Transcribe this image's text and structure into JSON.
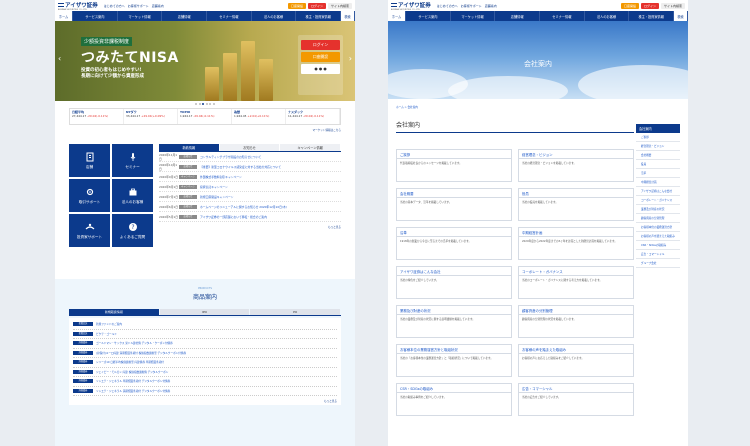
{
  "left": {
    "logo": {
      "name": "アイザワ証券",
      "sub": "AIZAWA SECURITIES CO.,LTD."
    },
    "top_links": [
      "はじめての方へ",
      "お客様サポート",
      "店舗案内"
    ],
    "buttons": {
      "account": "口座開設",
      "login": "ログイン",
      "search": "サイト内検索"
    },
    "nav": [
      "ホーム",
      "サービス案内",
      "マーケット情報",
      "店舗情報",
      "セミナー情報",
      "法人のお客様",
      "株主・投資家情報",
      "検索"
    ],
    "hero": {
      "tag": "少額投資非課税制度",
      "title": "つみたてNISA",
      "caption_1": "投資の初心者もはじめやすい!",
      "caption_2": "長期に向けて少額から資産形成",
      "login_label": "ログイン",
      "account_label": "口座開設",
      "prev": "‹",
      "next": "›"
    },
    "market": [
      {
        "name": "日経平均",
        "value": "27,444.17",
        "change": "-29.04(-0.11%)"
      },
      {
        "name": "NYダウ",
        "value": "33,444.17",
        "change": "+29.04(+0.09%)"
      },
      {
        "name": "TOPIX",
        "value": "1,944.17",
        "change": "-29.04(-0.11%)"
      },
      {
        "name": "為替",
        "value": "1,944.45",
        "change": "+2.04(+0.11%)"
      },
      {
        "name": "ナスダック",
        "value": "11,444.17",
        "change": "-29.04(-0.11%)"
      }
    ],
    "market_note": "マーケット情報はこちら",
    "tiles": [
      "店舗",
      "セミナー",
      "取引サポート",
      "法人のお客様",
      "投資家サポート",
      "よくあるご質問"
    ],
    "news_tabs": [
      "新着情報",
      "お知らせ",
      "キャンペーン情報"
    ],
    "news": [
      {
        "date": "2020年11月1日",
        "cat": "お知らせ",
        "title": "コンサルティングプラザ開設のお知らせについて"
      },
      {
        "date": "2020年10月1日",
        "cat": "お知らせ",
        "title": "【重要】新型コロナウイルス感染症に対する当社の対応について"
      },
      {
        "date": "2020年9月1日",
        "cat": "キャンペーン",
        "title": "外国株式手数料割引キャンペーン"
      },
      {
        "date": "2020年8月1日",
        "cat": "キャンペーン",
        "title": "投資信託キャンペーン"
      },
      {
        "date": "2020年7月1日",
        "cat": "お知らせ",
        "title": "新規口座開設キャンペーン"
      },
      {
        "date": "2020年6月1日",
        "cat": "お知らせ",
        "title": "ホームページのリニューアルに関するお知らせ 2020年12月10日(木)"
      },
      {
        "date": "2020年5月1日",
        "cat": "お知らせ",
        "title": "アイザワ証券の一部店舗において移転・統合のご案内"
      }
    ],
    "news_more": "もっと見る",
    "products": {
      "sub": "PRODUCTS",
      "title": "商品案内",
      "tabs": [
        "新規取扱情報",
        "IPO",
        "PO"
      ],
      "items": [
        {
          "cat": "投資信託",
          "title": "新規ファンドのご案内"
        },
        {
          "cat": "投資信託",
          "title": "ピクテ・ゴールド"
        },
        {
          "cat": "外国債券",
          "title": "ゴールドマン・サックス 米ドル建社債 デジタル・クーポン付債券"
        },
        {
          "cat": "外国債券",
          "title": "(担保付)ユーロ円建 満期償還条項付 株価指数連動型 デジタルクーポン付債券"
        },
        {
          "cat": "外国債券",
          "title": "シリーズ10 日経平均株価連動型 円建債券 早期償還条項付"
        },
        {
          "cat": "外国債券",
          "title": "ジェイピー・モルガン 円建 株価指数連動債 デジタルクーポン"
        },
        {
          "cat": "外国債券",
          "title": "ソシエテ・ジェネラル 早期償還条項付 デジタルクーポン付債券"
        },
        {
          "cat": "外国債券",
          "title": "ソシエテ・ジェネラル 満期償還条項付 デジタルクーポン付債券"
        }
      ],
      "more": "もっと見る"
    }
  },
  "right": {
    "page_title": "会社案内",
    "breadcrumb": "ホーム > 会社案内",
    "cards": [
      {
        "title": "ご挨拶",
        "desc": "代表取締役社長からのメッセージを掲載しています。"
      },
      {
        "title": "経営理念・ビジョン",
        "desc": "当社の経営理念・ビジョンを掲載しています。"
      },
      {
        "title": "会社概要",
        "desc": "当社の基本データ、沿革を掲載しています。"
      },
      {
        "title": "役員",
        "desc": "当社の役員を掲載しています。"
      },
      {
        "title": "沿革",
        "desc": "1918年の創業から今日に至るまでの沿革を掲載しています。"
      },
      {
        "title": "中期経営計画",
        "desc": "2020年度から2022年度までの3ヶ年を計画とした新経営計画を掲載しています。"
      },
      {
        "title": "アイザワ証券はこんな会社",
        "desc": "当社の特色をご紹介しています。"
      },
      {
        "title": "コーポレート・ガバナンス",
        "desc": "当社のコーポレート・ガバナンスに関する考え方を掲載しています。"
      },
      {
        "title": "業務及び財産の状況",
        "desc": "当社の業務及び財産の状況に関する説明書類を掲載しています。"
      },
      {
        "title": "顧客資産の分別管理",
        "desc": "顧客資産の分別管理の状況を掲載しています。"
      },
      {
        "title": "お客様本位の業務運営方針と取組状況",
        "desc": "当社の「お客様本位の業務運営方針」と「取組状況」について掲載しています。"
      },
      {
        "title": "お客様の声を踏まえた取組み",
        "desc": "お客様の声にお応えした取組みをご紹介しています。"
      },
      {
        "title": "CSR・SDGsの取組み",
        "desc": "当社の取組み事例をご紹介しています。"
      },
      {
        "title": "広告・コマーシャル",
        "desc": "当社の広告をご紹介しています。"
      }
    ],
    "side_title": "会社案内",
    "side_items": [
      "ご挨拶",
      "経営理念・ビジョン",
      "会社概要",
      "役員",
      "沿革",
      "中期経営計画",
      "アイザワ証券はこんな会社",
      "コーポレート・ガバナンス",
      "業務及び財産の状況",
      "顧客資産の分別管理",
      "お客様本位の業務運営方針",
      "お客様の声を踏まえた取組み",
      "CSR・SDGsの取組み",
      "広告・コマーシャル",
      "グループ会社"
    ]
  },
  "colors": {
    "navy": "#0c3a8c",
    "accent_red": "#e5322d",
    "accent_orange": "#f39800",
    "link": "#1a56c7"
  }
}
